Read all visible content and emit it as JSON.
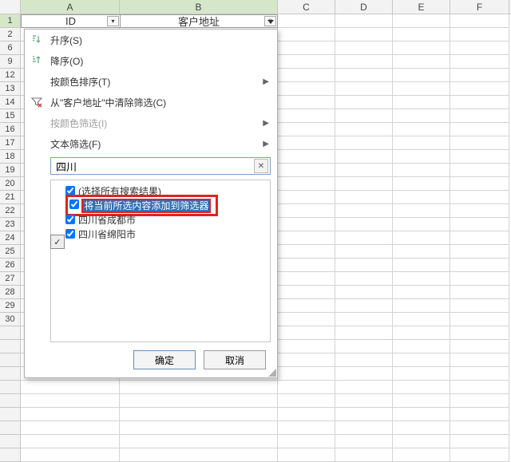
{
  "columns": [
    "A",
    "B",
    "C",
    "D",
    "E",
    "F"
  ],
  "row_numbers": [
    1,
    2,
    6,
    9,
    12,
    13,
    14,
    15,
    16,
    17,
    18,
    19,
    20,
    21,
    22,
    23,
    24,
    25,
    26,
    27,
    28,
    29,
    30
  ],
  "table": {
    "colA_header": "ID",
    "colB_header": "客户地址"
  },
  "menu": {
    "sort_asc": "升序(S)",
    "sort_desc": "降序(O)",
    "sort_by_color": "按颜色排序(T)",
    "clear_filter": "从\"客户地址\"中清除筛选(C)",
    "filter_by_color": "按颜色筛选(I)",
    "text_filters": "文本筛选(F)"
  },
  "search": {
    "value": "四川",
    "clear": "✕"
  },
  "results": {
    "select_all_search": "(选择所有搜索结果)",
    "add_current_to_filter": "将当前所选内容添加到筛选器",
    "item1": "四川省成都市",
    "item2": "四川省绵阳市"
  },
  "buttons": {
    "ok": "确定",
    "cancel": "取消"
  },
  "icons": {
    "check": "✓"
  }
}
